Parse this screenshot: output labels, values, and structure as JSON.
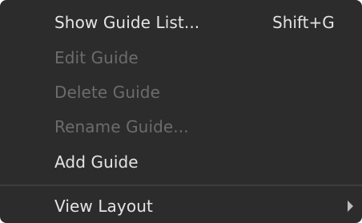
{
  "menu": {
    "items": [
      {
        "label": "Show Guide List...",
        "shortcut": "Shift+G",
        "enabled": true
      },
      {
        "label": "Edit Guide",
        "enabled": false
      },
      {
        "label": "Delete Guide",
        "enabled": false
      },
      {
        "label": "Rename Guide...",
        "enabled": false
      },
      {
        "label": "Add Guide",
        "enabled": true
      },
      {
        "label": "View Layout",
        "enabled": true,
        "submenu_icon": "submenu-arrow-icon"
      }
    ]
  },
  "colors": {
    "menu_background": "#2c2c2c",
    "enabled_text": "#e4e4e4",
    "disabled_text": "#6c6c6c",
    "separator": "#3d3d3d"
  }
}
